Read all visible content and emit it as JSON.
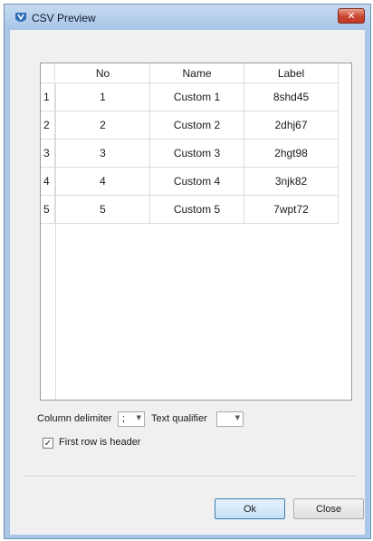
{
  "window": {
    "title": "CSV Preview",
    "close_glyph": "✕"
  },
  "grid": {
    "columns": [
      "No",
      "Name",
      "Label"
    ],
    "rows": [
      {
        "row_number": "1",
        "no": "1",
        "name": "Custom 1",
        "label": "8shd45"
      },
      {
        "row_number": "2",
        "no": "2",
        "name": "Custom 2",
        "label": "2dhj67"
      },
      {
        "row_number": "3",
        "no": "3",
        "name": "Custom 3",
        "label": "2hgt98"
      },
      {
        "row_number": "4",
        "no": "4",
        "name": "Custom 4",
        "label": "3njk82"
      },
      {
        "row_number": "5",
        "no": "5",
        "name": "Custom 5",
        "label": "7wpt72"
      }
    ]
  },
  "options": {
    "column_delimiter_label": "Column delimiter",
    "column_delimiter_value": ";",
    "text_qualifier_label": "Text qualifier",
    "text_qualifier_value": "",
    "dropdown_glyph": "▼",
    "first_row_header_label": "First row is header",
    "first_row_header_checked": true,
    "check_glyph": "✓"
  },
  "buttons": {
    "ok_label": "Ok",
    "close_label": "Close"
  },
  "colors": {
    "title_bar": "#a9c6e6",
    "close_button": "#c9452f",
    "ok_border": "#3c7fb1"
  }
}
